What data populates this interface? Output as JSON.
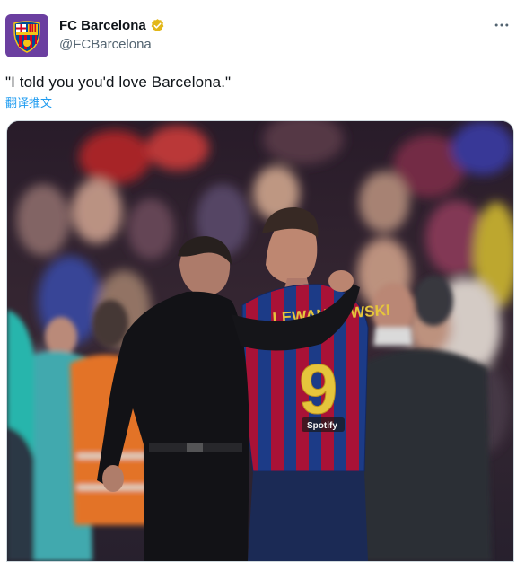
{
  "author": {
    "display_name": "FC Barcelona",
    "handle": "@FCBarcelona",
    "verified_icon": "verified-badge-gold-icon",
    "avatar_icon": "fcb-crest-icon"
  },
  "tweet": {
    "text": "\"I told you you'd love Barcelona.\"",
    "translate_label": "翻译推文"
  },
  "media": {
    "jersey_name": "LEWANDOWSKI",
    "jersey_number": "9",
    "sponsor": "Spotify"
  },
  "colors": {
    "accent_link": "#1d9bf0",
    "verified_gold": "#e2b719",
    "avatar_bg": "#6b3fa0",
    "secondary_text": "#536471"
  },
  "icons": {
    "more": "more-horizontal-icon"
  }
}
